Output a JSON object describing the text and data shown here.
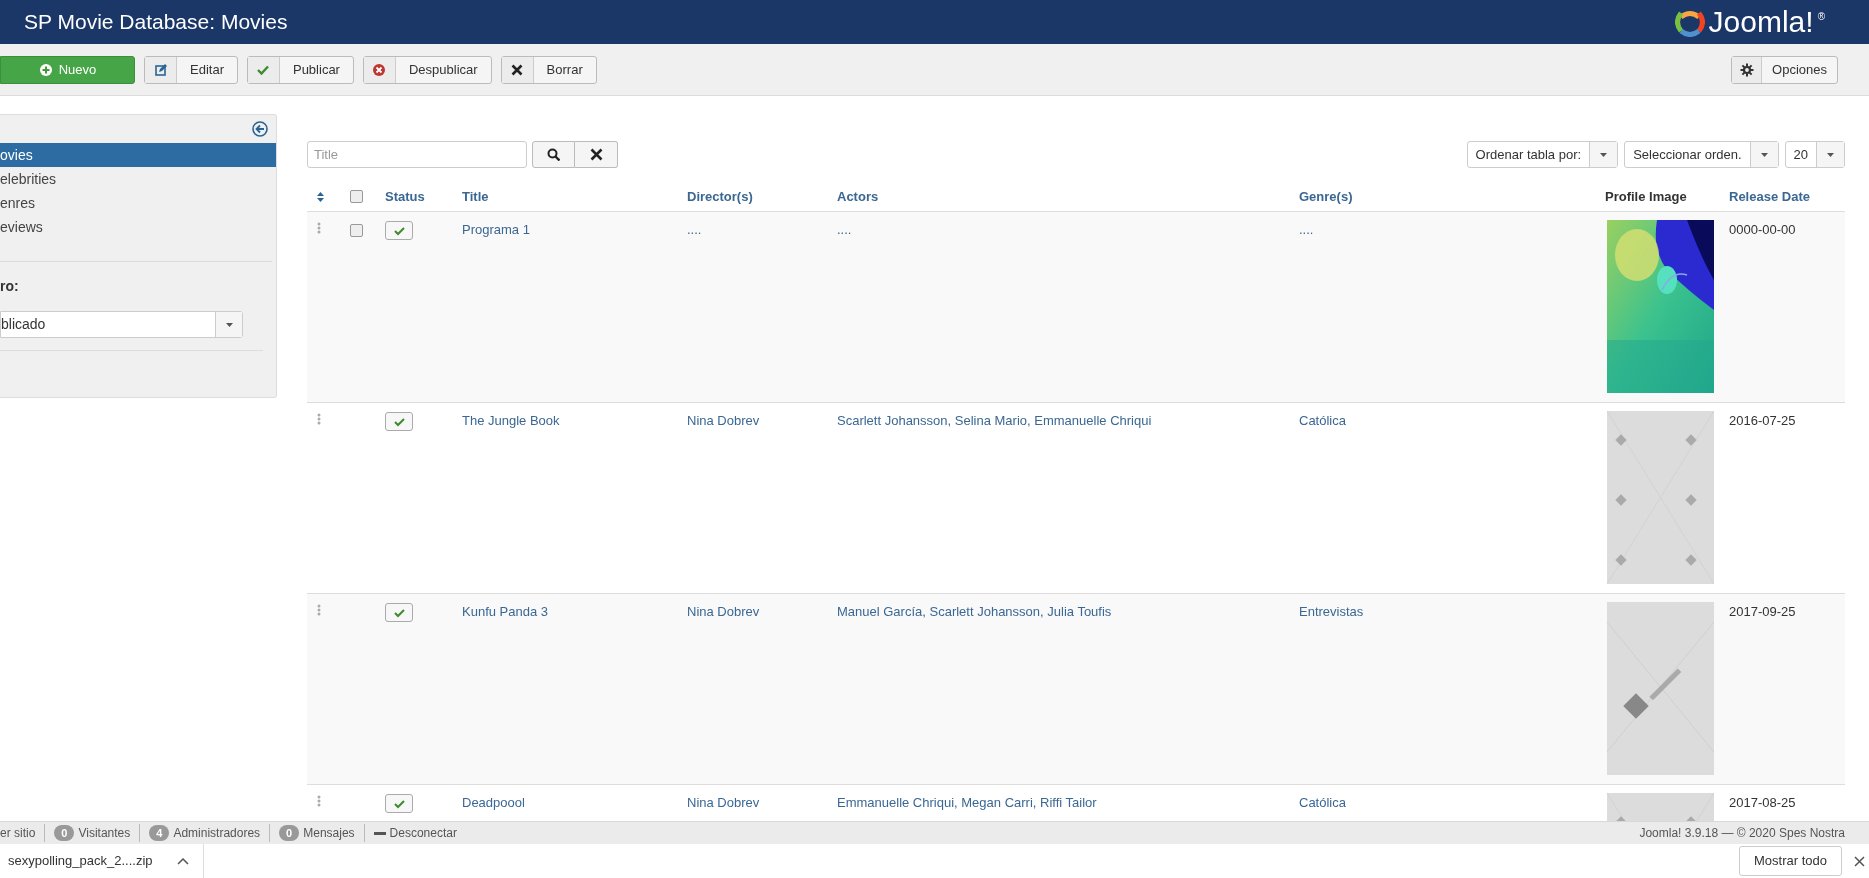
{
  "header": {
    "title": "SP Movie Database: Movies",
    "logo_text": "Joomla!",
    "logo_mark": "®"
  },
  "toolbar": {
    "buttons": [
      {
        "label": "Nuevo",
        "kind": "new"
      },
      {
        "label": "Editar",
        "kind": "edit"
      },
      {
        "label": "Publicar",
        "kind": "publish"
      },
      {
        "label": "Despublicar",
        "kind": "unpublish"
      },
      {
        "label": "Borrar",
        "kind": "delete"
      }
    ],
    "options": "Opciones"
  },
  "sidebar": {
    "items": [
      {
        "label": "ovies",
        "selected": true
      },
      {
        "label": "elebrities",
        "selected": false
      },
      {
        "label": "enres",
        "selected": false
      },
      {
        "label": "eviews",
        "selected": false
      }
    ],
    "filter_label": "ro:",
    "filter_value": "blicado"
  },
  "search": {
    "placeholder": "Title"
  },
  "sort_controls": [
    {
      "value": "Ordenar tabla por:"
    },
    {
      "value": "Seleccionar orden."
    },
    {
      "value": "20"
    }
  ],
  "table": {
    "columns": [
      {
        "label": "Status",
        "sortable": true
      },
      {
        "label": "Title",
        "sortable": true
      },
      {
        "label": "Director(s)",
        "sortable": true
      },
      {
        "label": "Actors",
        "sortable": true
      },
      {
        "label": "Genre(s)",
        "sortable": true
      },
      {
        "label": "Profile Image",
        "sortable": false
      },
      {
        "label": "Release Date",
        "sortable": true
      }
    ],
    "header_checkbox": {
      "checked": false
    },
    "rows": [
      {
        "checkbox": {
          "checked": false
        },
        "published": true,
        "title": "Programa 1",
        "director": "....",
        "actors": "....",
        "genre": "....",
        "date": "0000-00-00"
      },
      {
        "published": true,
        "title": "The Jungle Book",
        "director": "Nina Dobrev",
        "actors": "Scarlett Johansson, Selina Mario, Emmanuelle Chriqui",
        "genre": "Católica",
        "date": "2016-07-25"
      },
      {
        "published": true,
        "title": "Kunfu Panda 3",
        "director": "Nina Dobrev",
        "actors": "Manuel García, Scarlett Johansson, Julia Toufis",
        "genre": "Entrevistas",
        "date": "2017-09-25"
      },
      {
        "published": true,
        "title": "Deadpoool",
        "director": "Nina Dobrev",
        "actors": "Emmanuelle Chriqui, Megan Carri, Riffi Tailor",
        "genre": "Católica",
        "date": "2017-08-25"
      }
    ]
  },
  "status_bar": {
    "items": [
      {
        "label": "er sitio"
      },
      {
        "count": "0",
        "label": "Visitantes"
      },
      {
        "count": "4",
        "label": "Administradores"
      },
      {
        "count": "0",
        "label": "Mensajes"
      },
      {
        "label": "Desconectar",
        "kind": "logout"
      }
    ],
    "version": "Joomla! 3.9.18  —  © 2020 Spes Nostra"
  },
  "download_bar": {
    "file": "sexypolling_pack_2....zip",
    "show_all": "Mostrar todo"
  }
}
